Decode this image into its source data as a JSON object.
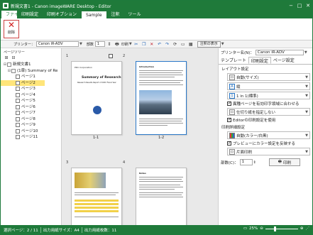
{
  "window": {
    "title": "新規文書1 - Canon imageWARE Desktop - Editor",
    "minimize": "−",
    "maximize": "□",
    "close": "✕"
  },
  "ribbon": {
    "tabs": [
      "ファイル",
      "印刷設定",
      "印刷オプション",
      "Sample",
      "注釈",
      "ツール"
    ],
    "active_tab": "Sample",
    "delete_label": "削除",
    "group_label": "表示"
  },
  "toolbar": {
    "printer_label": "プリンター：",
    "printer_value": "Canon iR-ADV",
    "copies_label": "部数",
    "copies_value": "1",
    "print_label": "印刷",
    "annotation_button": "注釈の表示"
  },
  "sidebar": {
    "title": "ページツリー",
    "doc_label": "新規文書1",
    "group_label": "(1章) Summary of Re",
    "pages": [
      "ページ1",
      "ページ2",
      "ページ3",
      "ページ4",
      "ページ5",
      "ページ6",
      "ページ7",
      "ページ8",
      "ページ9",
      "ページ10",
      "ページ11"
    ],
    "selected_page": "ページ2"
  },
  "preview": {
    "page1_number": "1",
    "page2_number": "2",
    "page3_number": "3",
    "page4_number": "4",
    "page1_label": "1-1",
    "page2_label": "1-2",
    "page1_heading": "Summary of Research",
    "page1_sub": "Research Results Report of 20XX Fiscal Year",
    "page1_org": "PDC Corporation",
    "page2_heading": "Introduction",
    "page4_heading": "Notes"
  },
  "settings_panel": {
    "printer_label": "プリンター名(N)：",
    "printer_value": "Canon iR-ADV",
    "tabs": [
      "テンプレート",
      "印刷設定",
      "ページ設定"
    ],
    "active_tab": "印刷設定",
    "layout_section": "レイアウト設定",
    "page_size": "自動(サイズ)",
    "orientation": "縦",
    "pages_per_sheet": "1 in 1(標準)",
    "fit_check": "異種ページを有効印字領域に合わせる",
    "finishing": "仕切り紙を指定しない",
    "editor_check": "Editorの印刷設定を使用",
    "color_section": "印刷詳細設定",
    "color_mode": "自動(カラー/白黒)",
    "preview_check": "プレビューにカラー設定を反映する",
    "duplex": "片面印刷",
    "copies_label": "部数(C)：",
    "copies_value": "1",
    "print_button": "印刷"
  },
  "status": {
    "selected_pages": "選択ページ：2 / 11",
    "output_size": "出力用紙サイズ：A4",
    "output_count": "出力用紙枚数：11",
    "zoom": "25%"
  }
}
